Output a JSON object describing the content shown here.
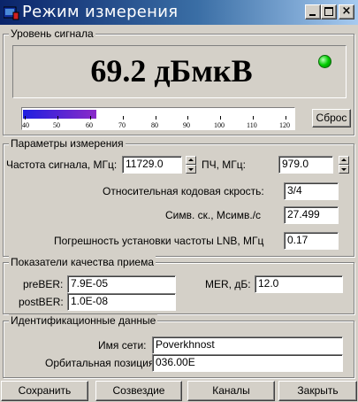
{
  "window": {
    "title": "Режим измерения",
    "icon": "window-app-icon",
    "caption_buttons": {
      "minimize": "minimize-icon",
      "maximize": "maximize-icon",
      "close": "close-icon"
    },
    "close_glyph": "×"
  },
  "signal_level": {
    "legend": "Уровень сигнала",
    "value": "69.2 дБмкВ",
    "status_color": "#00cc00",
    "meter": {
      "fill_fraction": 0.27,
      "fill_color_start": "#2020e0",
      "fill_color_end": "#8a2ac8",
      "scale_labels": [
        "40",
        "50",
        "60",
        "70",
        "80",
        "90",
        "100",
        "110",
        "120"
      ]
    },
    "reset_label": "Сброс"
  },
  "params": {
    "legend": "Параметры измерения",
    "freq_label": "Частота сигнала, МГц:",
    "freq_value": "11729.0",
    "if_label": "ПЧ, МГц:",
    "if_value": "979.0",
    "code_rate_label": "Относительная кодовая скрость:",
    "code_rate_value": "3/4",
    "symbol_rate_label": "Симв. ск.,  Мсимв./с",
    "symbol_rate_value": "27.499",
    "lnb_error_label": "Погрешность установки частоты LNB, МГц",
    "lnb_error_value": "0.17"
  },
  "quality": {
    "legend": "Показатели качества приема",
    "preber_label": "preBER:",
    "preber_value": "7.9E-05",
    "postber_label": "postBER:",
    "postber_value": "1.0E-08",
    "mer_label": "MER, дБ:",
    "mer_value": "12.0"
  },
  "identification": {
    "legend": "Идентификационные данные",
    "network_label": "Имя сети:",
    "network_value": "Poverkhnost",
    "orbital_label": "Орбитальная позиция:",
    "orbital_value": "036.00E"
  },
  "buttons": {
    "save": "Сохранить",
    "constellation": "Созвездие",
    "channels": "Каналы",
    "close": "Закрыть"
  }
}
